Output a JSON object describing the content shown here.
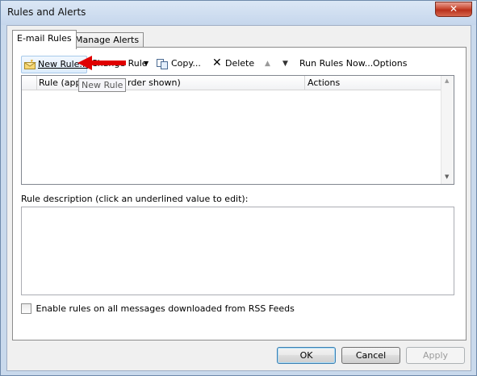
{
  "window": {
    "title": "Rules and Alerts",
    "close_glyph": "✕"
  },
  "tabs": [
    {
      "label": "E-mail Rules"
    },
    {
      "label": "Manage Alerts"
    }
  ],
  "toolbar": {
    "new_rule": "New Rule...",
    "change_rule": "Change Rule",
    "copy": "Copy...",
    "delete": "Delete",
    "run_rules_now": "Run Rules Now...",
    "options": "Options"
  },
  "rules_list": {
    "columns": [
      {
        "label": "Rule (applied in the order shown)"
      },
      {
        "label": "Actions"
      }
    ],
    "visible_column_fragments": {
      "rule_left": "Rule (appl",
      "rule_right": "rder shown)"
    },
    "rows": []
  },
  "tooltip": {
    "text": "New Rule"
  },
  "description": {
    "label": "Rule description (click an underlined value to edit):"
  },
  "rss_checkbox": {
    "label": "Enable rules on all messages downloaded from RSS Feeds",
    "checked": false
  },
  "buttons": {
    "ok": "OK",
    "cancel": "Cancel",
    "apply": "Apply"
  },
  "annotation": {
    "color": "#e00000",
    "icon": "red-arrow-icon"
  }
}
